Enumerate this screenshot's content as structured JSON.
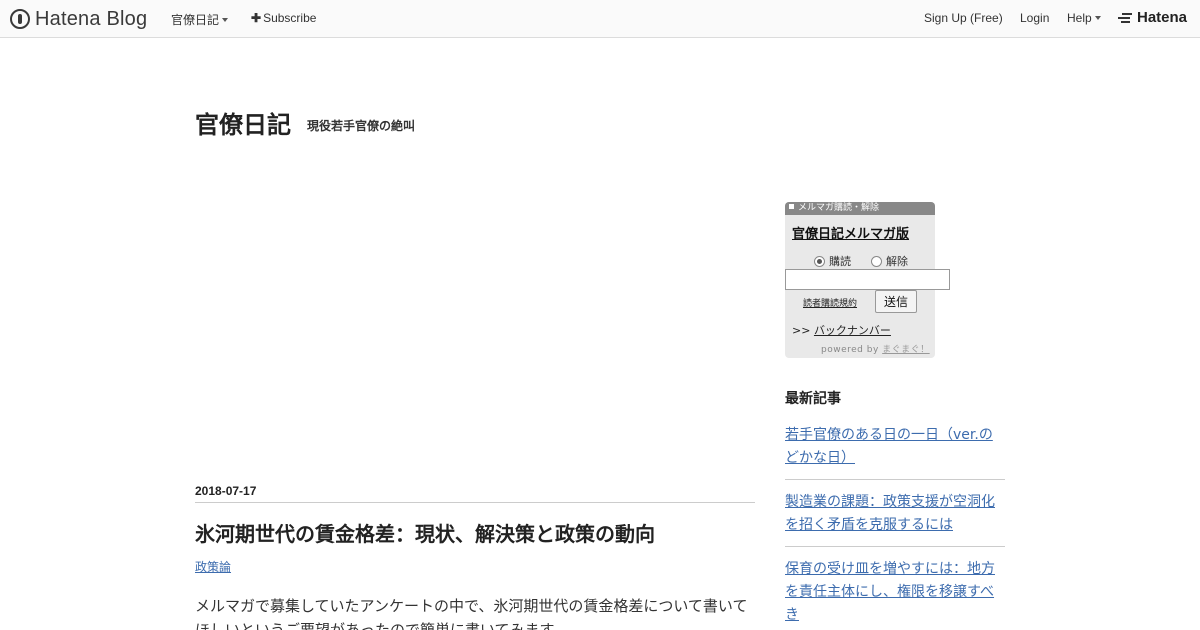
{
  "topbar": {
    "logo_text": "Hatena Blog",
    "blog_menu": "官僚日記",
    "subscribe": "Subscribe",
    "signup": "Sign Up (Free)",
    "login": "Login",
    "help": "Help",
    "hatena": "Hatena"
  },
  "blog": {
    "title": "官僚日記",
    "description": "現役若手官僚の絶叫"
  },
  "entry": {
    "date": "2018-07-17",
    "title": "氷河期世代の賃金格差：現状、解決策と政策の動向",
    "category": "政策論",
    "body": "メルマガで募集していたアンケートの中で、氷河期世代の賃金格差について書いてほしいというご要望があったので簡単に書いてみます。"
  },
  "mag": {
    "header": "メルマガ購読・解除",
    "title": "官僚日記メルマガ版",
    "subscribe_label": "購読",
    "unsubscribe_label": "解除",
    "email_value": "",
    "terms": "読者購読規約",
    "submit": "送信",
    "back_prefix": ">>",
    "back_label": "バックナンバー",
    "powered_prefix": "powered by",
    "powered_link": "まぐまぐ！"
  },
  "recent": {
    "title": "最新記事",
    "items": [
      {
        "label": "若手官僚のある日の一日（ver.のどかな日）"
      },
      {
        "label": "製造業の課題：政策支援が空洞化を招く矛盾を克服するには"
      },
      {
        "label": "保育の受け皿を増やすには：地方を責任主体にし、権限を移譲すべき"
      }
    ]
  }
}
